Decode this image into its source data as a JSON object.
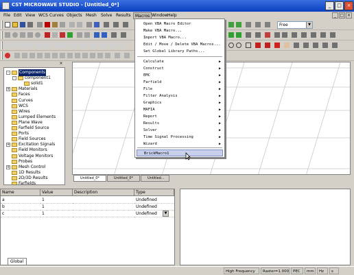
{
  "window": {
    "title": "CST MICROWAVE STUDIO - [Untitled_0*]",
    "minimize": "_",
    "restore": "□",
    "close": "×"
  },
  "menubar": [
    "File",
    "Edit",
    "View",
    "WCS",
    "Curves",
    "Objects",
    "Mesh",
    "Solve",
    "Results",
    "Macros",
    "Window",
    "Help"
  ],
  "mdi_controls": [
    "_",
    "□",
    "×"
  ],
  "toolbar": {
    "frequency_combo": "Free"
  },
  "macros_menu": {
    "top_items": [
      "Open VBA Macro Editor",
      "Make VBA Macro...",
      "Import VBA Macro...",
      "Edit / Move / Delete VBA Macros...",
      "Set Global Library Paths..."
    ],
    "sub_items": [
      "Calculate",
      "Construct",
      "EMC",
      "Farfield",
      "File",
      "Filter Analysis",
      "Graphics",
      "MAFIA",
      "Report",
      "Results",
      "Solver",
      "Time Signal Processing",
      "Wizard"
    ],
    "bottom_items": [
      "BrickMacro1"
    ],
    "submenu_arrow": "▶"
  },
  "tree": {
    "items": [
      {
        "label": "Components",
        "level": 0,
        "expander": "-"
      },
      {
        "label": "component1",
        "level": 1,
        "expander": "-"
      },
      {
        "label": "solid1",
        "level": 2,
        "expander": ""
      },
      {
        "label": "Materials",
        "level": 0,
        "expander": "+"
      },
      {
        "label": "Faces",
        "level": 0,
        "expander": ""
      },
      {
        "label": "Curves",
        "level": 0,
        "expander": ""
      },
      {
        "label": "WCS",
        "level": 0,
        "expander": ""
      },
      {
        "label": "Wires",
        "level": 0,
        "expander": ""
      },
      {
        "label": "Lumped Elements",
        "level": 0,
        "expander": ""
      },
      {
        "label": "Plane Wave",
        "level": 0,
        "expander": ""
      },
      {
        "label": "Farfield Source",
        "level": 0,
        "expander": ""
      },
      {
        "label": "Ports",
        "level": 0,
        "expander": ""
      },
      {
        "label": "Field Sources",
        "level": 0,
        "expander": ""
      },
      {
        "label": "Excitation Signals",
        "level": 0,
        "expander": "+"
      },
      {
        "label": "Field Monitors",
        "level": 0,
        "expander": ""
      },
      {
        "label": "Voltage Monitors",
        "level": 0,
        "expander": ""
      },
      {
        "label": "Probes",
        "level": 0,
        "expander": ""
      },
      {
        "label": "Mesh Control",
        "level": 0,
        "expander": "+"
      },
      {
        "label": "1D Results",
        "level": 0,
        "expander": ""
      },
      {
        "label": "2D/3D Results",
        "level": 0,
        "expander": ""
      },
      {
        "label": "Farfields",
        "level": 0,
        "expander": ""
      }
    ],
    "close_glyph": "×"
  },
  "doc_tabs": [
    "Untitled_0*",
    "Untitled_0*",
    "Untitled..."
  ],
  "params": {
    "headers": [
      "Name",
      "Value",
      "Description",
      "Type"
    ],
    "rows": [
      {
        "name": "a",
        "value": "1",
        "description": "",
        "type": "Undefined"
      },
      {
        "name": "b",
        "value": "1",
        "description": "",
        "type": "Undefined"
      },
      {
        "name": "c",
        "value": "1",
        "description": "",
        "type": "Undefined"
      }
    ],
    "tab": "Global"
  },
  "statusbar": {
    "mode": "High Frequency",
    "raster": "Raster=1.000",
    "pec": "PEC",
    "mm": "mm",
    "hz": "Hz",
    "s": "s"
  }
}
